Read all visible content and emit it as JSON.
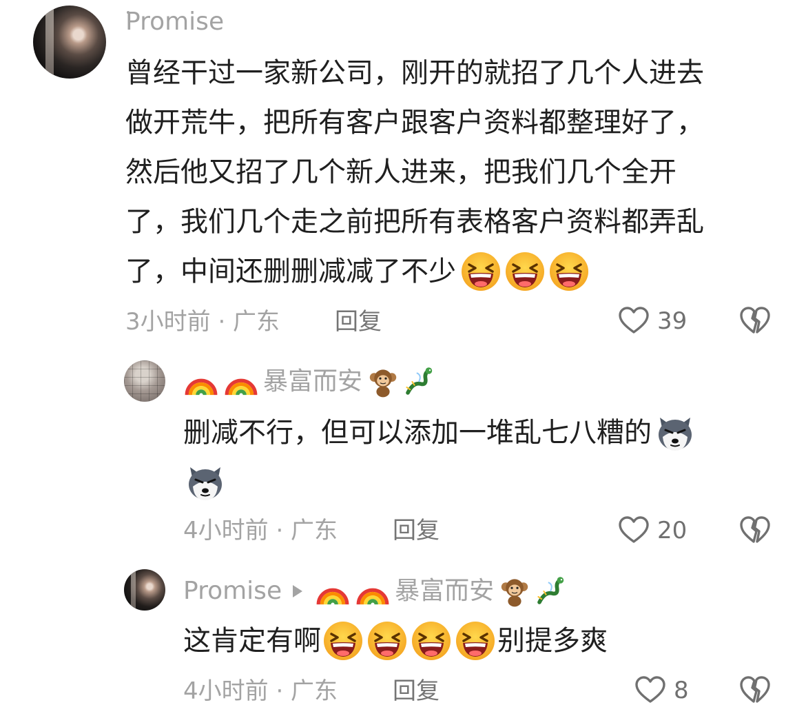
{
  "comments": [
    {
      "username": "Promise",
      "lines": [
        "曾经干过一家新公司，刚开的就招了几个人进去",
        "做开荒牛，把所有客户跟客户资料都整理好了，",
        "然后他又招了几个新人进来，把我们几个全开",
        "了，我们几个走之前把所有表格客户资料都弄乱",
        "了，中间还删删减减了不少"
      ],
      "emoji": [
        "grinning-squint-emoji",
        "grinning-squint-emoji",
        "grinning-squint-emoji"
      ],
      "time": "3小时前 · 广东",
      "reply": "回复",
      "likes": "39"
    },
    {
      "username": "暴富而安",
      "name_emojis": [
        "rainbow-emoji",
        "rainbow-emoji",
        "monkey-emoji",
        "dragon-emoji"
      ],
      "line1": "删减不行，但可以添加一堆乱七八糟的",
      "emoji": [
        "husky-emoji",
        "husky-emoji"
      ],
      "time": "4小时前 · 广东",
      "reply": "回复",
      "likes": "20"
    },
    {
      "username": "Promise",
      "reply_to": "暴富而安",
      "text_before": "这肯定有啊",
      "text_after": "别提多爽",
      "emoji": [
        "grinning-squint-emoji",
        "grinning-squint-emoji",
        "grinning-squint-emoji",
        "grinning-squint-emoji"
      ],
      "time": "4小时前 · 广东",
      "reply": "回复",
      "likes": "8"
    }
  ],
  "colors": {
    "text": "#1f1f1f",
    "muted": "#a3a3a3",
    "icon": "#707070"
  }
}
